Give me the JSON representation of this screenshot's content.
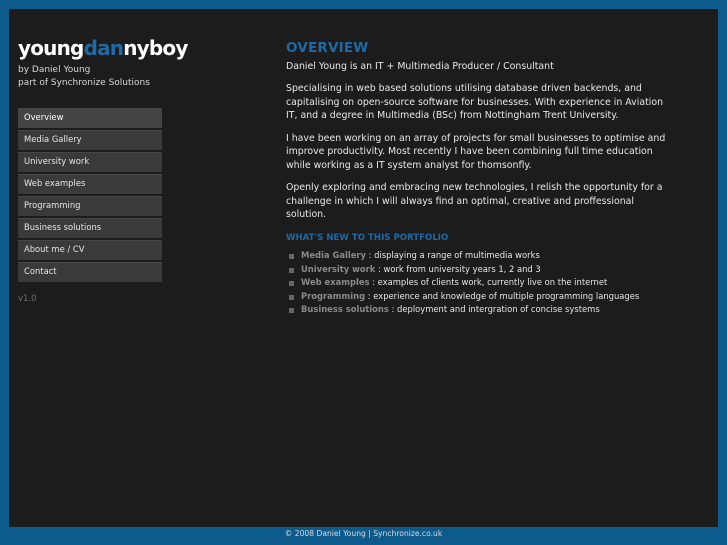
{
  "logo": {
    "part1": "young",
    "part2": "dan",
    "part3": "nyboy"
  },
  "byline": {
    "line1": "by Daniel Young",
    "line2": "part of Synchronize Solutions"
  },
  "nav": [
    {
      "label": "Overview"
    },
    {
      "label": "Media Gallery"
    },
    {
      "label": "University work"
    },
    {
      "label": "Web examples"
    },
    {
      "label": "Programming"
    },
    {
      "label": "Business solutions"
    },
    {
      "label": "About me / CV"
    },
    {
      "label": "Contact"
    }
  ],
  "version": "v1.0",
  "main": {
    "heading": "OVERVIEW",
    "intro": "Daniel Young is an IT + Multimedia Producer / Consultant",
    "para1": "Specialising in web based solutions utilising database driven backends, and capitalising on open-source software for businesses. With experience in Aviation IT, and a degree in Multimedia (BSc) from Nottingham Trent University.",
    "para2": "I have been working on an array of projects for small businesses to optimise and improve productivity. Most recently I have been combining full time education while working as a IT system analyst for thomsonfly.",
    "para3": "Openly exploring and embracing new technologies, I relish the opportunity for a challenge in which I will always find an optimal, creative and proffessional solution.",
    "news_heading": "WHAT'S NEW TO THIS PORTFOLIO",
    "news": [
      {
        "link": "Media Gallery",
        "text": " : displaying a range of multimedia works"
      },
      {
        "link": "University work",
        "text": " : work from university years 1, 2 and 3"
      },
      {
        "link": "Web examples",
        "text": " : examples of clients work, currently live on the internet"
      },
      {
        "link": "Programming",
        "text": " : experience and knowledge of multiple programming languages"
      },
      {
        "link": "Business solutions",
        "text": " : deployment and intergration of concise systems"
      }
    ]
  },
  "footer": "© 2008 Daniel Young | Synchronize.co.uk",
  "colors": {
    "accent": "#1e6aa5",
    "background": "#0d5a8c",
    "panel": "#1c1c1c"
  }
}
